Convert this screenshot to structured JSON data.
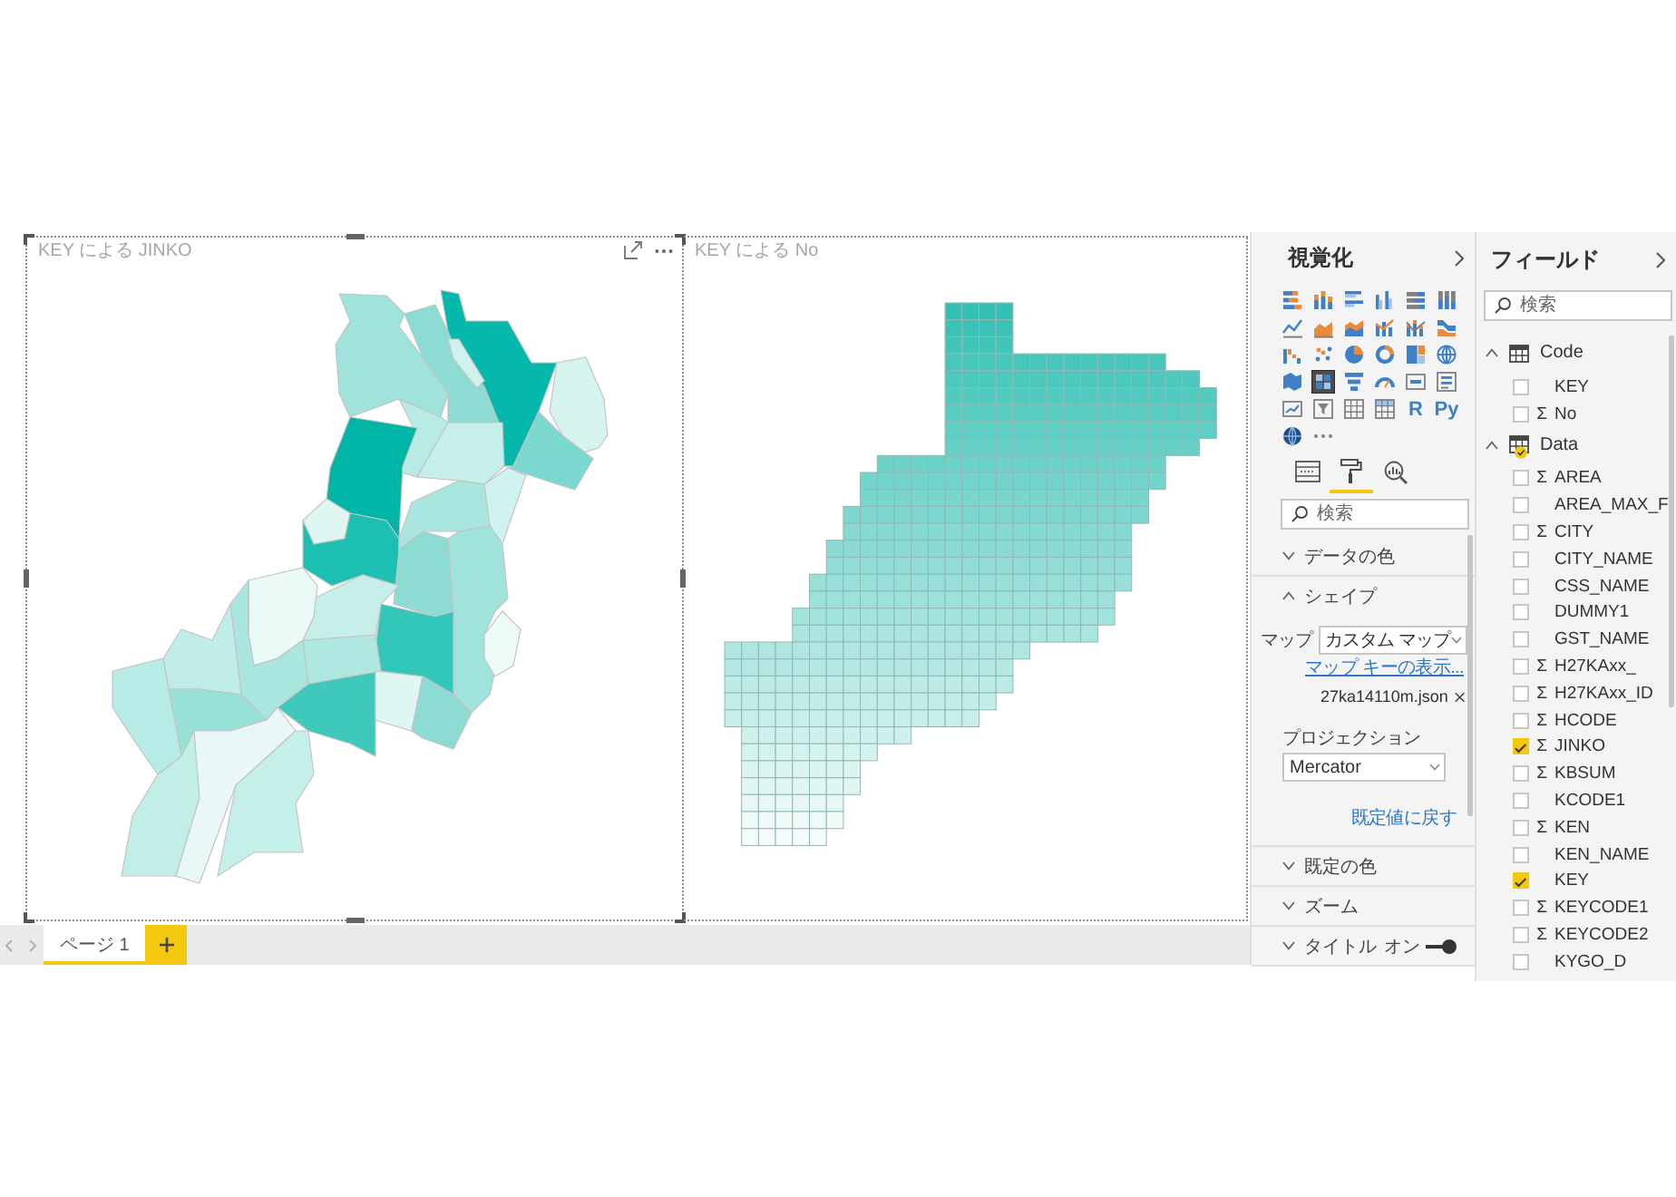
{
  "report": {
    "visuals": [
      {
        "kind": "shape_map",
        "title": "KEY による JINKO",
        "selected": true
      },
      {
        "kind": "grid_map",
        "title": "KEY による No",
        "selected": false
      }
    ]
  },
  "page_tabs": [
    {
      "label": "ページ 1",
      "selected": true
    }
  ],
  "visualizations": {
    "title": "視覚化",
    "gallery": [
      {
        "selected": false
      },
      {
        "selected": false
      },
      {
        "selected": false
      },
      {
        "selected": false
      },
      {
        "selected": false
      },
      {
        "selected": false
      },
      {
        "selected": false
      },
      {
        "selected": false
      },
      {
        "selected": false
      },
      {
        "selected": false
      },
      {
        "selected": false
      },
      {
        "selected": false
      },
      {
        "selected": false
      },
      {
        "selected": false
      },
      {
        "selected": false
      },
      {
        "selected": false
      },
      {
        "selected": false
      },
      {
        "selected": false
      },
      {
        "selected": false
      },
      {
        "selected": true
      },
      {
        "selected": false
      },
      {
        "selected": false
      },
      {
        "selected": false
      },
      {
        "selected": false
      },
      {
        "selected": false
      },
      {
        "selected": false
      },
      {
        "selected": false
      },
      {
        "selected": false
      },
      {
        "selected": false,
        "label": "R"
      },
      {
        "selected": false,
        "label": "Py"
      },
      {
        "selected": false
      },
      {
        "selected": false
      }
    ],
    "pane_tabs": [
      {
        "selected": false
      },
      {
        "selected": true
      },
      {
        "selected": false
      }
    ],
    "search": {
      "placeholder": "検索"
    },
    "sections": [
      {
        "label": "データの色",
        "expanded": false
      },
      {
        "label": "シェイプ",
        "expanded": true,
        "map": {
          "label": "マップ",
          "value": "カスタム マップ"
        },
        "map_key_link": "マップ キーの表示...",
        "file": "27ka14110m.json",
        "projection": {
          "label": "プロジェクション",
          "value": "Mercator"
        },
        "reset_link": "既定値に戻す"
      },
      {
        "label": "既定の色",
        "expanded": false
      },
      {
        "label": "ズーム",
        "expanded": false
      },
      {
        "label": "タイトル",
        "expanded": false,
        "toggle": {
          "label": "オン",
          "on": true
        }
      }
    ]
  },
  "fields": {
    "title": "フィールド",
    "search": {
      "placeholder": "検索"
    },
    "tables": [
      {
        "name": "Code",
        "expanded": true,
        "in_use": false,
        "fields": [
          {
            "name": "KEY",
            "checked": false
          },
          {
            "name": "No",
            "checked": false,
            "mark": "Σ"
          }
        ]
      },
      {
        "name": "Data",
        "expanded": true,
        "in_use": true,
        "fields": [
          {
            "name": "AREA",
            "checked": false,
            "mark": "Σ"
          },
          {
            "name": "AREA_MAX_F",
            "checked": false
          },
          {
            "name": "CITY",
            "checked": false,
            "mark": "Σ"
          },
          {
            "name": "CITY_NAME",
            "checked": false
          },
          {
            "name": "CSS_NAME",
            "checked": false
          },
          {
            "name": "DUMMY1",
            "checked": false
          },
          {
            "name": "GST_NAME",
            "checked": false
          },
          {
            "name": "H27KAxx_",
            "checked": false,
            "mark": "Σ"
          },
          {
            "name": "H27KAxx_ID",
            "checked": false,
            "mark": "Σ"
          },
          {
            "name": "HCODE",
            "checked": false,
            "mark": "Σ"
          },
          {
            "name": "JINKO",
            "checked": true,
            "mark": "Σ"
          },
          {
            "name": "KBSUM",
            "checked": false,
            "mark": "Σ"
          },
          {
            "name": "KCODE1",
            "checked": false
          },
          {
            "name": "KEN",
            "checked": false,
            "mark": "Σ"
          },
          {
            "name": "KEN_NAME",
            "checked": false
          },
          {
            "name": "KEY",
            "checked": true
          },
          {
            "name": "KEYCODE1",
            "checked": false,
            "mark": "Σ"
          },
          {
            "name": "KEYCODE2",
            "checked": false,
            "mark": "Σ"
          },
          {
            "name": "KYGO_D",
            "checked": false
          }
        ]
      }
    ]
  }
}
